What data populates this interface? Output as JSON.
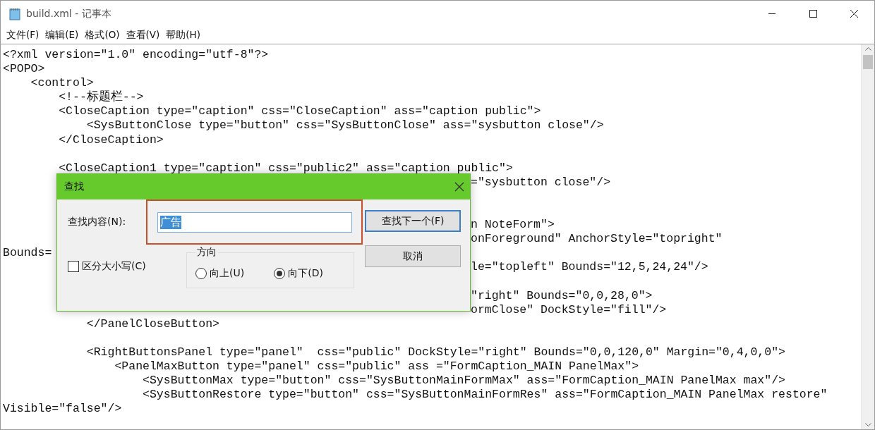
{
  "window": {
    "title": "build.xml - 记事本"
  },
  "menu": [
    "文件(F)",
    "编辑(E)",
    "格式(O)",
    "查看(V)",
    "帮助(H)"
  ],
  "editor": {
    "lines": [
      {
        "kind": "code",
        "text": "<?xml version=\"1.0\" encoding=\"utf-8\"?>"
      },
      {
        "kind": "code",
        "text": "<POPO>"
      },
      {
        "kind": "code",
        "text": "    <control>"
      },
      {
        "kind": "code",
        "text": "        <!--标题栏-->"
      },
      {
        "kind": "code",
        "text": "        <CloseCaption type=\"caption\" css=\"CloseCaption\" ass=\"caption public\">"
      },
      {
        "kind": "code",
        "text": "            <SysButtonClose type=\"button\" css=\"SysButtonClose\" ass=\"sysbutton close\"/>"
      },
      {
        "kind": "code",
        "text": "        </CloseCaption>"
      },
      {
        "kind": "blank"
      },
      {
        "kind": "code",
        "text": "        <CloseCaption1 type=\"caption\" css=\"public2\" ass=\"caption public\">"
      },
      {
        "kind": "covered",
        "tail": "=\"sysbutton close\"/>"
      },
      {
        "kind": "blank"
      },
      {
        "kind": "blank"
      },
      {
        "kind": "covered",
        "tail": "n NoteForm\">"
      },
      {
        "kind": "covered",
        "tail": "onForeground\" AnchorStyle=\"topright\""
      },
      {
        "kind": "code",
        "text": "Bounds="
      },
      {
        "kind": "covered",
        "tail": "le=\"topleft\" Bounds=\"12,5,24,24\"/>"
      },
      {
        "kind": "blank"
      },
      {
        "kind": "covered",
        "tail": "\"right\" Bounds=\"0,0,28,0\">"
      },
      {
        "kind": "covered",
        "tail": "ormClose\" DockStyle=\"fill\"/>"
      },
      {
        "kind": "code",
        "text": "            </PanelCloseButton>"
      },
      {
        "kind": "blank"
      },
      {
        "kind": "code",
        "text": "            <RightButtonsPanel type=\"panel\"  css=\"public\" DockStyle=\"right\" Bounds=\"0,0,120,0\" Margin=\"0,4,0,0\">"
      },
      {
        "kind": "code",
        "text": "                <PanelMaxButton type=\"panel\" css=\"public\" ass =\"FormCaption_MAIN PanelMax\">"
      },
      {
        "kind": "code",
        "text": "                    <SysButtonMax type=\"button\" css=\"SysButtonMainFormMax\" ass=\"FormCaption_MAIN PanelMax max\"/>"
      },
      {
        "kind": "code",
        "text": "                    <SysButtonRestore type=\"button\" css=\"SysButtonMainFormRes\" ass=\"FormCaption_MAIN PanelMax restore\""
      },
      {
        "kind": "code",
        "text": "Visible=\"false\"/>"
      }
    ]
  },
  "find_dialog": {
    "title": "查找",
    "label": "查找内容(N):",
    "value": "广告",
    "value_selected": true,
    "highlighted": true,
    "match_case": {
      "label": "区分大小写(C)",
      "checked": false
    },
    "direction": {
      "title": "方向",
      "options": [
        {
          "label": "向上(U)",
          "selected": false
        },
        {
          "label": "向下(D)",
          "selected": true
        }
      ]
    },
    "buttons": [
      {
        "label": "查找下一个(F)",
        "focused": true
      },
      {
        "label": "取消",
        "focused": false
      }
    ]
  }
}
